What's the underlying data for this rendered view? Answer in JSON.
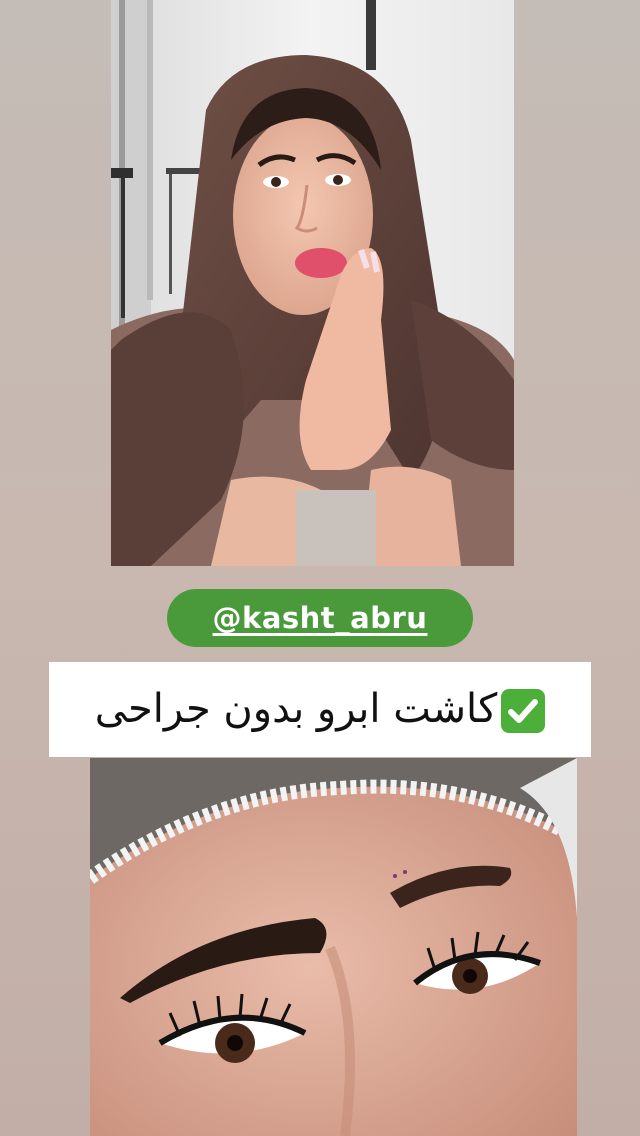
{
  "story": {
    "mention": "@kasht_abru",
    "caption": "کاشت ابرو بدون جراحی",
    "caption_icon": "check-mark-button-icon",
    "accent_color": "#4a9a3c"
  },
  "media": {
    "top_photo": "woman-in-hijab-photo",
    "bottom_photo": "eyebrow-closeup-photo"
  }
}
